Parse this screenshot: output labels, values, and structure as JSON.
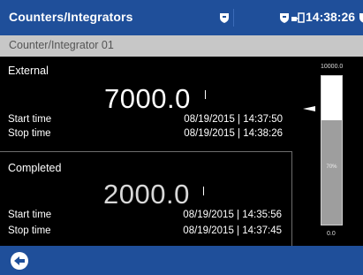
{
  "header": {
    "title": "Counters/Integrators",
    "clock": "14:38:26",
    "icons": [
      "shield-icon",
      "shield-icon",
      "network-icon",
      "shield-icon"
    ]
  },
  "subheader": {
    "title": "Counter/Integrator 01"
  },
  "external": {
    "label": "External",
    "value": "7000.0",
    "start_label": "Start time",
    "start_value": "08/19/2015 | 14:37:50",
    "stop_label": "Stop time",
    "stop_value": "08/19/2015 | 14:38:26"
  },
  "completed": {
    "label": "Completed",
    "value": "2000.0",
    "start_label": "Start time",
    "start_value": "08/19/2015 | 14:35:56",
    "stop_label": "Stop time",
    "stop_value": "08/19/2015 | 14:37:45"
  },
  "gauge": {
    "max_label": "10000.0",
    "min_label": "0.0",
    "percent_label": "70%",
    "fill_fraction": 0.7
  },
  "footer": {
    "back_icon": "back-arrow-icon"
  },
  "colors": {
    "bar_blue": "#1f4f9a",
    "subheader_gray": "#c7c7c7",
    "gauge_fill": "#9e9e9e"
  }
}
